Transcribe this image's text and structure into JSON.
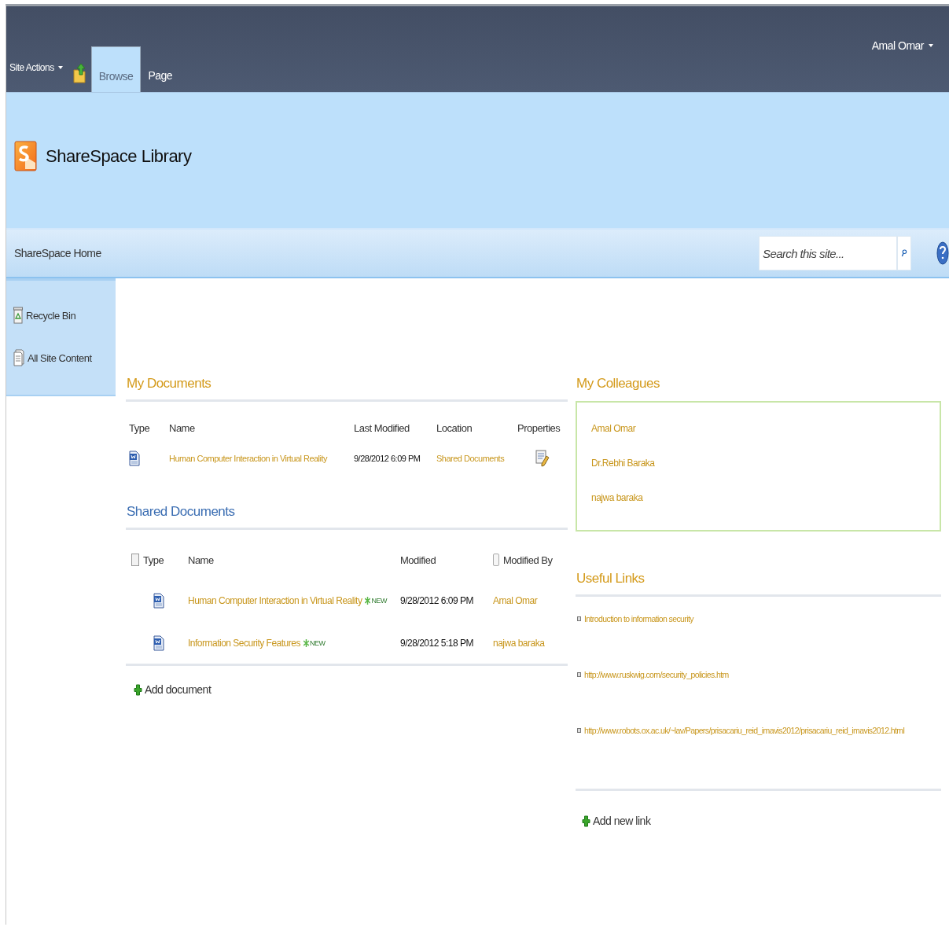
{
  "ribbon": {
    "site_actions": "Site Actions",
    "tabs": [
      {
        "label": "Browse",
        "selected": true
      },
      {
        "label": "Page",
        "selected": false
      }
    ],
    "user": "Amal Omar"
  },
  "header": {
    "title": "ShareSpace Library"
  },
  "nav": {
    "home": "ShareSpace Home",
    "search": {
      "placeholder": "Search this site..."
    }
  },
  "sidebar": {
    "items": [
      {
        "label": "Recycle Bin",
        "kind": "recycle"
      },
      {
        "label": "All Site Content",
        "kind": "content"
      }
    ]
  },
  "my_documents": {
    "title": "My Documents",
    "columns": [
      "Type",
      "Name",
      "Last Modified",
      "Location",
      "Properties"
    ],
    "rows": [
      {
        "name": "Human Computer Interaction in Virtual Reality",
        "last_modified": "9/28/2012 6:09 PM",
        "location": "Shared Documents"
      }
    ]
  },
  "shared_documents": {
    "title": "Shared Documents",
    "select_all_checked": false,
    "columns": [
      "Type",
      "Name",
      "Modified",
      "Modified By"
    ],
    "rows": [
      {
        "name": "Human Computer Interaction in Virtual Reality",
        "badge": "NEW",
        "modified": "9/28/2012 6:09 PM",
        "modified_by": "Amal Omar"
      },
      {
        "name": "Information Security Features",
        "badge": "NEW",
        "modified": "9/28/2012 5:18 PM",
        "modified_by": "najwa baraka"
      }
    ],
    "add": "Add document"
  },
  "my_colleagues": {
    "title": "My Colleagues",
    "items": [
      "Amal Omar",
      "Dr.Rebhi Baraka",
      "najwa baraka"
    ]
  },
  "useful_links": {
    "title": "Useful Links",
    "items": [
      "Introduction to information security",
      "http://www.ruskwig.com/security_policies.htm",
      "http://www.robots.ox.ac.uk/~lav/Papers/prisacariu_reid_imavis2012/prisacariu_reid_imavis2012.html"
    ],
    "add": "Add new link"
  }
}
